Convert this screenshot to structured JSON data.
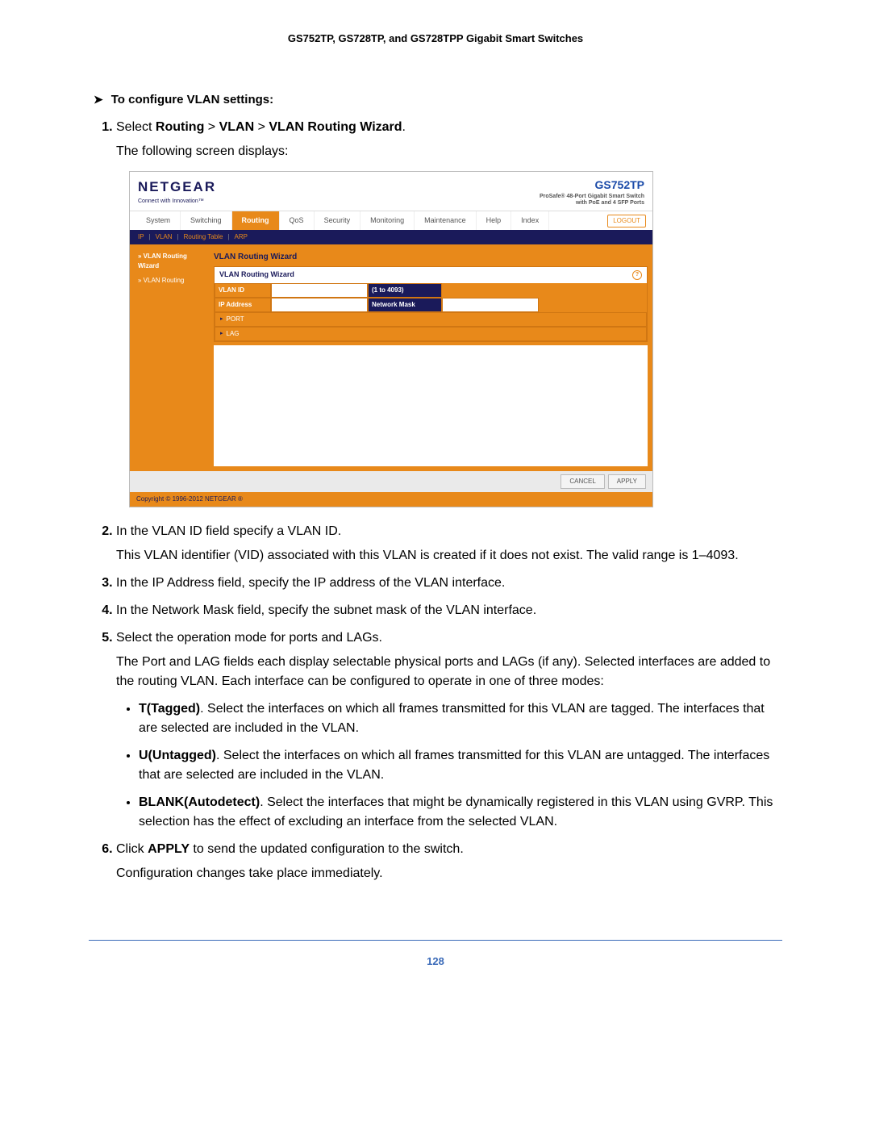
{
  "doc_header": "GS752TP, GS728TP, and GS728TPP Gigabit Smart Switches",
  "lead": "To configure VLAN settings:",
  "steps": {
    "s1a": "Select ",
    "s1b": "Routing",
    "s1c": " > ",
    "s1d": "VLAN",
    "s1e": " > ",
    "s1f": "VLAN Routing Wizard",
    "s1g": ".",
    "s1_sub": "The following screen displays:",
    "s2": "In the VLAN ID field specify a VLAN ID.",
    "s2_sub": "This VLAN identifier (VID) associated with this VLAN is created if it does not exist. The valid range is 1–4093.",
    "s3": "In the IP Address field, specify the IP address of the VLAN interface.",
    "s4": "In the Network Mask field, specify the subnet mask of the VLAN interface.",
    "s5": "Select the operation mode for ports and LAGs.",
    "s5_sub": "The Port and LAG fields each display selectable physical ports and LAGs (if any). Selected interfaces are added to the routing VLAN. Each interface can be configured to operate in one of three modes:",
    "b1h": "T(Tagged)",
    "b1": ". Select the interfaces on which all frames transmitted for this VLAN are tagged. The interfaces that are selected are included in the VLAN.",
    "b2h": "U(Untagged)",
    "b2": ". Select the interfaces on which all frames transmitted for this VLAN are untagged. The interfaces that are selected are included in the VLAN.",
    "b3h": "BLANK(Autodetect)",
    "b3": ". Select the interfaces that might be dynamically registered in this VLAN using GVRP. This selection has the effect of excluding an interface from the selected VLAN.",
    "s6a": "Click ",
    "s6b": "APPLY",
    "s6c": " to send the updated configuration to the switch.",
    "s6_sub": "Configuration changes take place immediately."
  },
  "screenshot": {
    "brand": "NETGEAR",
    "brand_tag": "Connect with Innovation™",
    "model": "GS752TP",
    "model_desc1": "ProSafe® 48-Port Gigabit Smart Switch",
    "model_desc2": "with PoE and 4 SFP Ports",
    "tabs": [
      "System",
      "Switching",
      "Routing",
      "QoS",
      "Security",
      "Monitoring",
      "Maintenance",
      "Help",
      "Index"
    ],
    "active_tab": "Routing",
    "logout": "LOGOUT",
    "subtabs": {
      "a": "IP",
      "b": "VLAN",
      "c": "Routing Table",
      "d": "ARP"
    },
    "side": {
      "i1": "VLAN Routing Wizard",
      "i2": "VLAN Routing"
    },
    "panel_title": "VLAN Routing Wizard",
    "box_header": "VLAN Routing Wizard",
    "form": {
      "vlan_id_label": "VLAN ID",
      "vlan_id_note": "(1 to 4093)",
      "ip_label": "IP Address",
      "mask_label": "Network Mask",
      "port": "PORT",
      "lag": "LAG"
    },
    "btn_cancel": "CANCEL",
    "btn_apply": "APPLY",
    "copyright": "Copyright © 1996-2012 NETGEAR ®"
  },
  "page_number": "128"
}
